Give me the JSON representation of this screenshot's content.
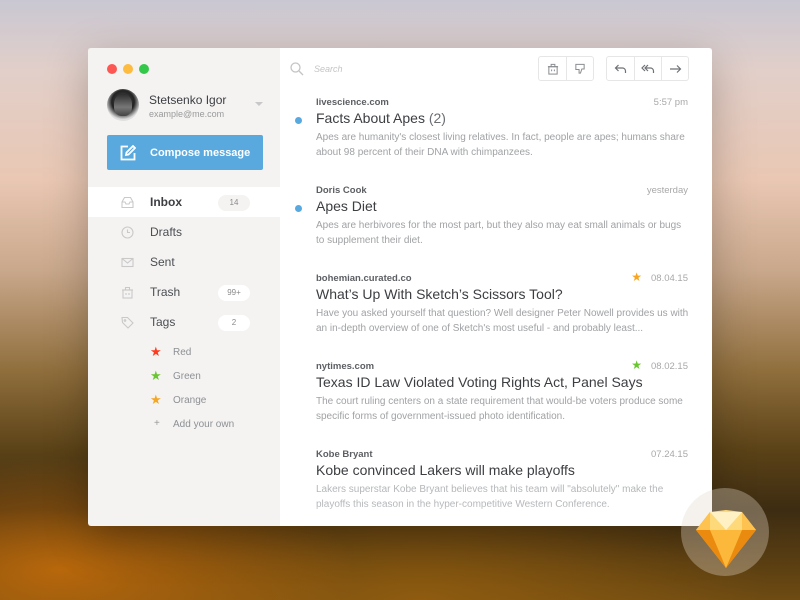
{
  "window": {
    "traffic_lights": [
      "close",
      "minimize",
      "maximize"
    ]
  },
  "profile": {
    "name": "Stetsenko Igor",
    "email": "example@me.com",
    "avatar_icon": "gorilla-avatar"
  },
  "compose": {
    "label": "Compose message",
    "icon": "edit-icon"
  },
  "nav": {
    "items": [
      {
        "label": "Inbox",
        "icon": "inbox-icon",
        "badge": "14",
        "active": true
      },
      {
        "label": "Drafts",
        "icon": "clock-icon",
        "badge": null
      },
      {
        "label": "Sent",
        "icon": "envelope-icon",
        "badge": null
      },
      {
        "label": "Trash",
        "icon": "trash-icon",
        "badge": "99+"
      },
      {
        "label": "Tags",
        "icon": "tag-icon",
        "badge": "2"
      }
    ]
  },
  "tags": {
    "items": [
      {
        "label": "Red",
        "color": "#ff3b1f",
        "icon": "star-icon"
      },
      {
        "label": "Green",
        "color": "#6ac630",
        "icon": "star-icon"
      },
      {
        "label": "Orange",
        "color": "#f5a623",
        "icon": "star-icon"
      }
    ],
    "add_label": "Add your own",
    "add_icon": "plus-icon"
  },
  "toolbar": {
    "search_placeholder": "Search",
    "buttons": [
      {
        "name": "delete",
        "icon": "trash-icon"
      },
      {
        "name": "dislike",
        "icon": "thumbs-down-icon"
      },
      {
        "name": "reply",
        "icon": "reply-icon"
      },
      {
        "name": "reply-all",
        "icon": "reply-all-icon"
      },
      {
        "name": "forward",
        "icon": "forward-icon"
      }
    ]
  },
  "emails": [
    {
      "sender": "livescience.com",
      "time": "5:57 pm",
      "subject": "Facts About Apes",
      "count": "(2)",
      "unread": true,
      "flag": null,
      "preview": "Apes are humanity's closest living relatives. In fact, people are apes; humans share about 98 percent of their DNA with chimpanzees."
    },
    {
      "sender": "Doris Cook",
      "time": "yesterday",
      "subject": "Apes Diet",
      "count": "",
      "unread": true,
      "flag": null,
      "preview": "Apes are herbivores for the most part, but they also may eat small animals or bugs to supplement their diet."
    },
    {
      "sender": "bohemian.curated.co",
      "time": "08.04.15",
      "subject": "What’s Up With Sketch’s Scissors Tool?",
      "count": "",
      "unread": false,
      "flag": "#f5a623",
      "preview": "Have you asked yourself that question? Well designer Peter Nowell provides us with an in-depth overview of one of Sketch's most useful - and probably least..."
    },
    {
      "sender": "nytimes.com",
      "time": "08.02.15",
      "subject": "Texas ID Law Violated Voting Rights Act, Panel Says",
      "count": "",
      "unread": false,
      "flag": "#6ac630",
      "preview": "The court ruling centers on a state requirement that would-be voters produce some specific forms of government-issued photo identification."
    },
    {
      "sender": "Kobe Bryant",
      "time": "07.24.15",
      "subject": "Kobe convinced Lakers will make playoffs",
      "count": "",
      "unread": false,
      "flag": null,
      "preview": "Lakers superstar Kobe Bryant believes that his team will \"absolutely\" make the playoffs this season in the hyper-competitive Western Conference."
    }
  ],
  "colors": {
    "accent": "#5aa9de",
    "sidebar_bg": "#f4f3f2",
    "text_primary": "#3c3e42",
    "text_muted": "#a0a2a5"
  },
  "branding": {
    "logo_icon": "sketch-diamond-icon"
  }
}
